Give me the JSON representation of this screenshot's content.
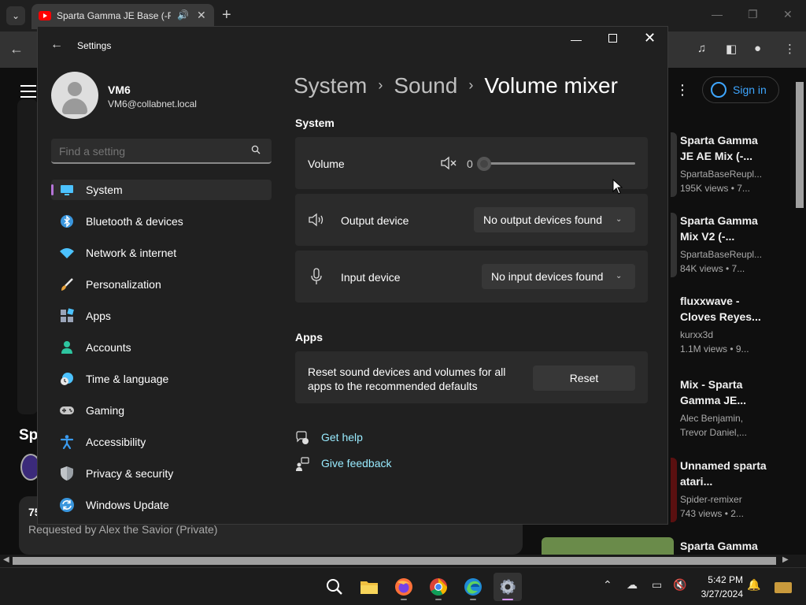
{
  "browser": {
    "tab_title": "Sparta Gamma JE Base (-Re",
    "tab_close": "✕",
    "new_tab": "+",
    "tab_dropdown": "⌄"
  },
  "youtube": {
    "sign_in": "Sign in",
    "channel_prefix": "Sp",
    "desc_count": "75",
    "requested_by": "Requested by Alex the Savior (Private)",
    "recommendations": [
      {
        "title": "Sparta Gamma JE AE Mix (-...",
        "channel": "SpartaBaseReupl...",
        "views": "195K views • 7..."
      },
      {
        "title": "Sparta Gamma Mix V2 (-...",
        "channel": "SpartaBaseReupl...",
        "views": "84K views • 7..."
      },
      {
        "title": "fluxxwave - Cloves Reyes...",
        "channel": "kurxx3d",
        "views": "1.1M views • 9..."
      },
      {
        "title": "Mix - Sparta Gamma JE...",
        "channel": "Alec Benjamin,",
        "views": "Trevor Daniel,..."
      },
      {
        "title": "Unnamed sparta atari...",
        "channel": "Spider-remixer",
        "views": "743 views • 2..."
      },
      {
        "title": "Sparta Gamma",
        "channel": "",
        "views": ""
      }
    ]
  },
  "settings": {
    "window_title": "Settings",
    "user": {
      "name": "VM6",
      "email": "VM6@collabnet.local"
    },
    "search_placeholder": "Find a setting",
    "nav": [
      {
        "label": "System",
        "icon": "monitor-icon",
        "color": "#4cc2ff"
      },
      {
        "label": "Bluetooth & devices",
        "icon": "bluetooth-icon",
        "color": "#3a96dd"
      },
      {
        "label": "Network & internet",
        "icon": "wifi-icon",
        "color": "#4cc2ff"
      },
      {
        "label": "Personalization",
        "icon": "brush-icon",
        "color": "#e8a33d"
      },
      {
        "label": "Apps",
        "icon": "apps-icon",
        "color": "#9aa4b8"
      },
      {
        "label": "Accounts",
        "icon": "person-icon",
        "color": "#2ec5a0"
      },
      {
        "label": "Time & language",
        "icon": "globe-clock-icon",
        "color": "#4cc2ff"
      },
      {
        "label": "Gaming",
        "icon": "gamepad-icon",
        "color": "#c8c8c8"
      },
      {
        "label": "Accessibility",
        "icon": "accessibility-icon",
        "color": "#3a9bf0"
      },
      {
        "label": "Privacy & security",
        "icon": "shield-icon",
        "color": "#9aa0a6"
      },
      {
        "label": "Windows Update",
        "icon": "update-icon",
        "color": "#3a96dd"
      }
    ],
    "breadcrumb": {
      "level1": "System",
      "level2": "Sound",
      "current": "Volume mixer",
      "sep": "›"
    },
    "system_section": "System",
    "volume": {
      "label": "Volume",
      "value": "0",
      "level": 0
    },
    "output": {
      "label": "Output device",
      "value": "No output devices found"
    },
    "input": {
      "label": "Input device",
      "value": "No input devices found"
    },
    "apps_section": "Apps",
    "reset": {
      "description": "Reset sound devices and volumes for all apps to the recommended defaults",
      "button": "Reset"
    },
    "links": {
      "help": "Get help",
      "feedback": "Give feedback"
    },
    "accent_color": "#b574d8"
  },
  "taskbar": {
    "time": "5:42 PM",
    "date": "3/27/2024"
  }
}
